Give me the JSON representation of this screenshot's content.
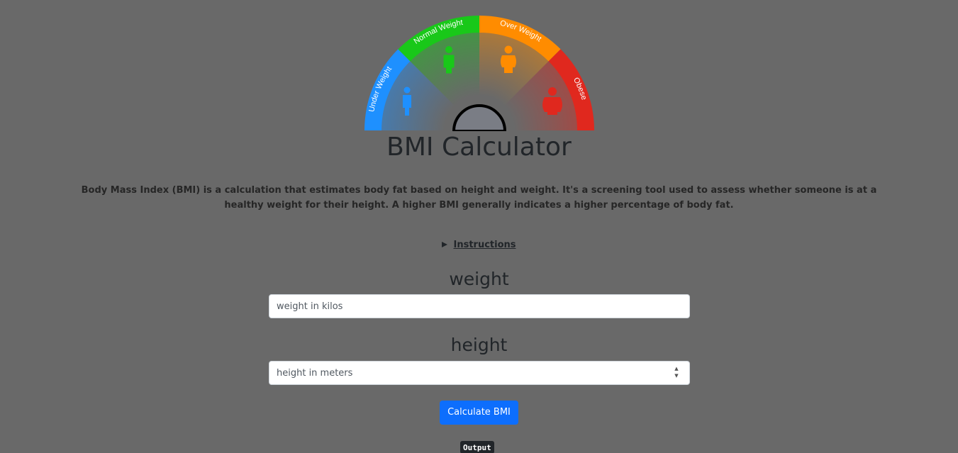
{
  "gauge": {
    "segments": [
      {
        "label": "Under Weight",
        "color": "#1e90ff"
      },
      {
        "label": "Normal Weight",
        "color": "#19c819"
      },
      {
        "label": "Over Weight",
        "color": "#ff8c00"
      },
      {
        "label": "Obese",
        "color": "#e0281e"
      }
    ]
  },
  "title": "BMI Calculator",
  "description": "Body Mass Index (BMI) is a calculation that estimates body fat based on height and weight. It's a screening tool used to assess whether someone is at a healthy weight for their height. A higher BMI generally indicates a higher percentage of body fat.",
  "instructions": {
    "summary": "Instructions"
  },
  "weight": {
    "label": "weight",
    "placeholder": "weight in kilos",
    "value": ""
  },
  "height": {
    "label": "height",
    "placeholder": "height in meters",
    "value": ""
  },
  "calculate_button": "Calculate BMI",
  "output_label": "Output"
}
